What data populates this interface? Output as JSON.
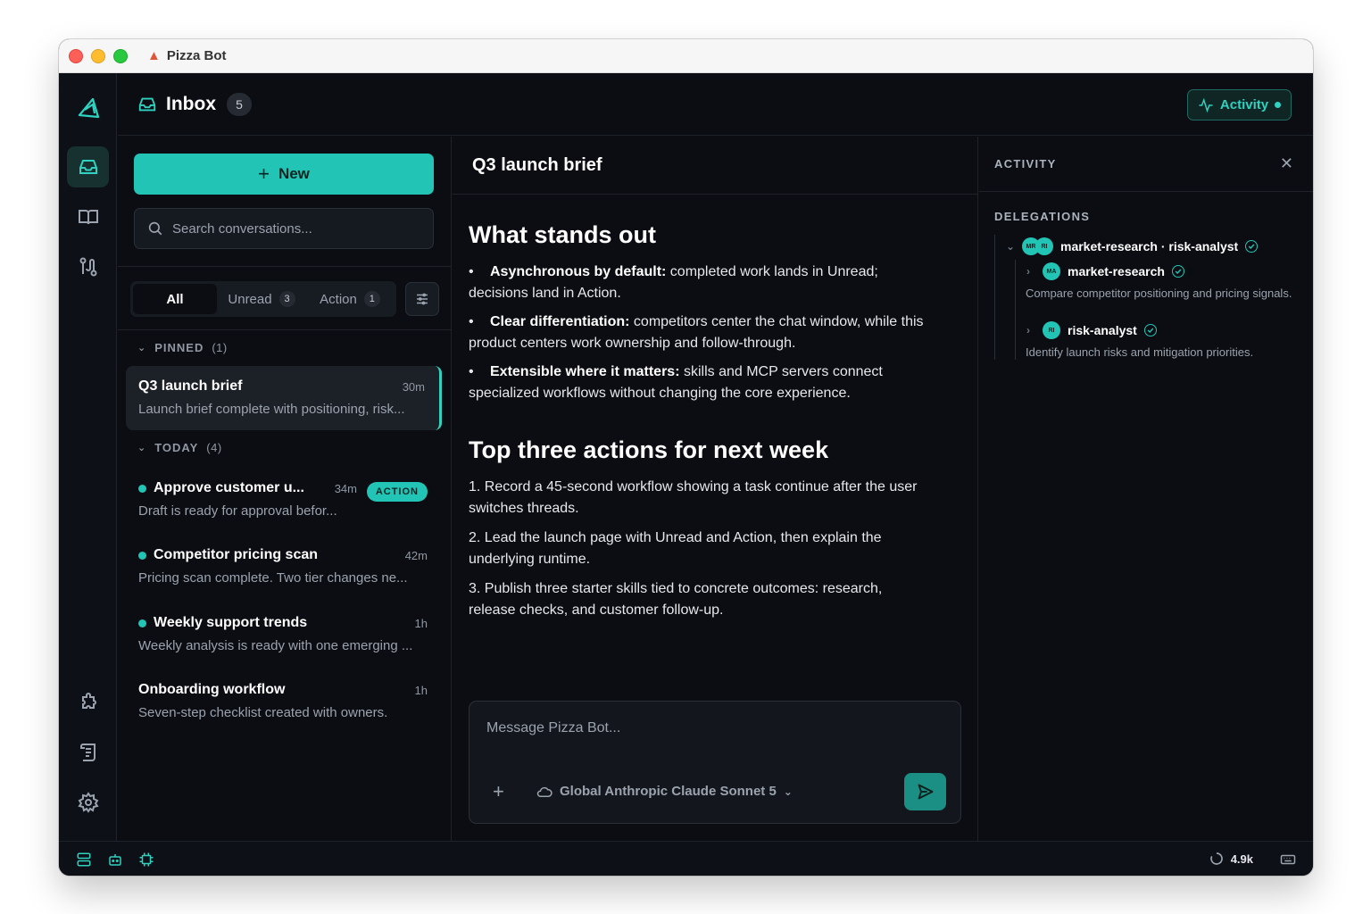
{
  "window": {
    "title": "Pizza Bot"
  },
  "header": {
    "inbox_label": "Inbox",
    "inbox_count": "5",
    "activity_label": "Activity"
  },
  "sidebar": {
    "new_label": "New",
    "search_placeholder": "Search conversations...",
    "filters": [
      {
        "label": "All",
        "count": ""
      },
      {
        "label": "Unread",
        "count": "3"
      },
      {
        "label": "Action",
        "count": "1"
      }
    ],
    "pinned": {
      "label": "PINNED",
      "count": "(1)"
    },
    "today": {
      "label": "TODAY",
      "count": "(4)"
    },
    "conversations": [
      {
        "title": "Q3 launch brief",
        "time": "30m",
        "preview": "Launch brief complete with positioning, risk...",
        "unread": false,
        "selected": true
      },
      {
        "title": "Approve customer u...",
        "time": "34m",
        "preview": "Draft is ready for approval befor...",
        "unread": true,
        "badge": "ACTION"
      },
      {
        "title": "Competitor pricing scan",
        "time": "42m",
        "preview": "Pricing scan complete. Two tier changes ne...",
        "unread": true
      },
      {
        "title": "Weekly support trends",
        "time": "1h",
        "preview": "Weekly analysis is ready with one emerging ...",
        "unread": true
      },
      {
        "title": "Onboarding workflow",
        "time": "1h",
        "preview": "Seven-step checklist created with owners.",
        "unread": false
      }
    ]
  },
  "main": {
    "title": "Q3 launch brief",
    "section1": {
      "heading": "What stands out",
      "bullets": [
        {
          "bold": "Asynchronous by default:",
          "text": " completed work lands in Unread; decisions land in Action."
        },
        {
          "bold": "Clear differentiation:",
          "text": " competitors center the chat window, while this product centers work ownership and follow-through."
        },
        {
          "bold": "Extensible where it matters:",
          "text": " skills and MCP servers connect specialized workflows without changing the core experience."
        }
      ]
    },
    "section2": {
      "heading": "Top three actions for next week",
      "items": [
        "1. Record a 45-second workflow showing a task continue after the user switches threads.",
        "2. Lead the launch page with Unread and Action, then explain the underlying runtime.",
        "3. Publish three starter skills tied to concrete outcomes: research, release checks, and customer follow-up."
      ]
    },
    "composer": {
      "placeholder": "Message Pizza Bot...",
      "model": "Global Anthropic Claude Sonnet 5"
    }
  },
  "activity": {
    "title": "ACTIVITY",
    "delegations_label": "DELEGATIONS",
    "group": {
      "label": "market-research · risk-analyst",
      "avatars": [
        "MR",
        "RI"
      ]
    },
    "children": [
      {
        "name": "market-research",
        "avatar": "MA",
        "desc": "Compare competitor positioning and pricing signals."
      },
      {
        "name": "risk-analyst",
        "avatar": "RI",
        "desc": "Identify launch risks and mitigation priorities."
      }
    ]
  },
  "statusbar": {
    "tokens": "4.9k"
  },
  "colors": {
    "accent": "#22c5b5",
    "background": "#0b0d12",
    "panel": "#13171d"
  },
  "icons": [
    "pizza-icon",
    "logo-icon",
    "inbox-icon",
    "book-icon",
    "route-icon",
    "puzzle-icon",
    "scroll-icon",
    "gear-icon",
    "pulse-icon",
    "plus-icon",
    "search-icon",
    "sliders-icon",
    "chevron-down-icon",
    "chevron-right-icon",
    "check-icon",
    "close-icon",
    "cloud-icon",
    "send-icon",
    "server-icon",
    "bot-icon",
    "chip-icon",
    "spinner-icon",
    "keyboard-icon"
  ]
}
